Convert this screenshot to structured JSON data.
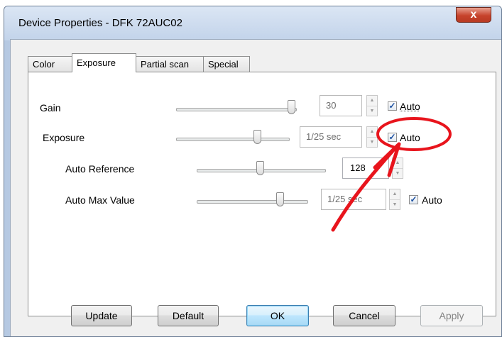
{
  "window": {
    "title": "Device Properties - DFK 72AUC02",
    "close_glyph": "x"
  },
  "tabs": [
    {
      "label": "Color",
      "active": false
    },
    {
      "label": "Exposure",
      "active": true
    },
    {
      "label": "Partial scan",
      "active": false
    },
    {
      "label": "Special",
      "active": false
    }
  ],
  "rows": {
    "gain": {
      "label": "Gain",
      "value": "30",
      "slider_level": 0.97,
      "auto_label": "Auto",
      "auto_checked": true
    },
    "exposure": {
      "label": "Exposure",
      "value": "1/25 sec",
      "slider_level": 0.73,
      "auto_label": "Auto",
      "auto_checked": true
    },
    "auto_reference": {
      "label": "Auto Reference",
      "value": "128",
      "slider_level": 0.5
    },
    "auto_max_value": {
      "label": "Auto Max Value",
      "value": "1/25 sec",
      "slider_level": 0.76,
      "auto_label": "Auto",
      "auto_checked": true
    }
  },
  "buttons": {
    "update": "Update",
    "default": "Default",
    "ok": "OK",
    "cancel": "Cancel",
    "apply": "Apply"
  },
  "annotation": {
    "color": "#e8141c",
    "shape": "circle-and-arrow"
  }
}
